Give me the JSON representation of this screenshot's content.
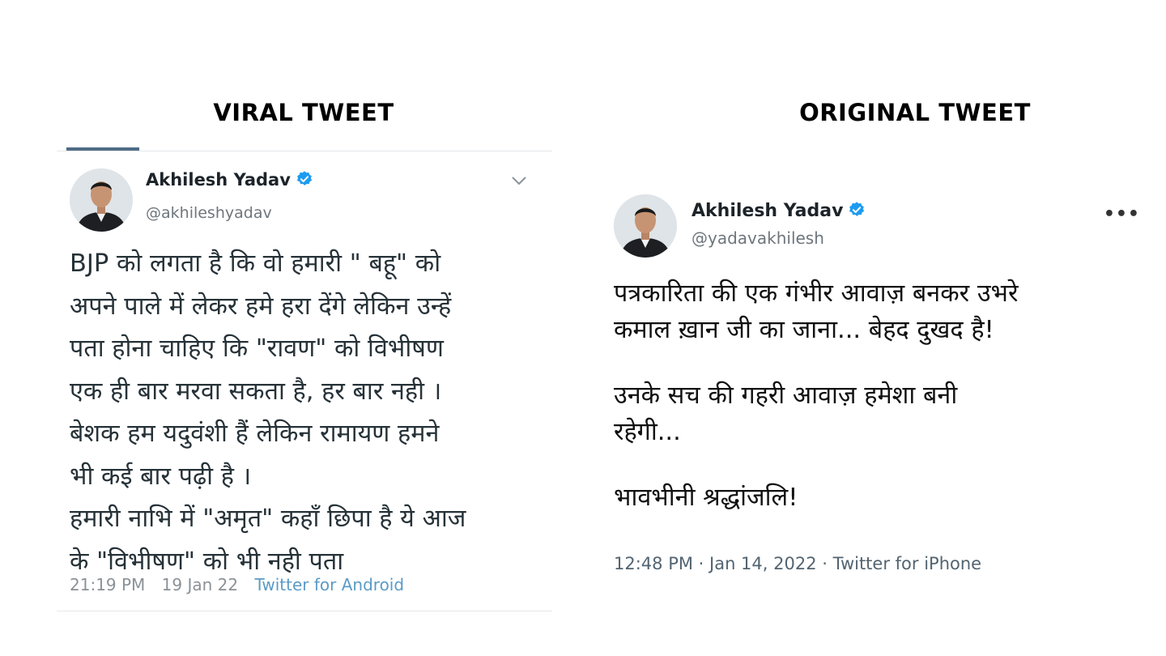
{
  "headings": {
    "left": "VIRAL TWEET",
    "right": "ORIGINAL TWEET"
  },
  "viral_tweet": {
    "author_name": "Akhilesh Yadav",
    "handle": "@akhileshyadav",
    "lines": [
      "BJP को लगता है कि वो हमारी \" बहू\" को",
      "अपने पाले में लेकर हमे हरा देंगे लेकिन उन्हें",
      "पता होना चाहिए कि \"रावण\" को विभीषण",
      "एक ही बार मरवा सकता है, हर बार नही ।",
      "बेशक हम यदुवंशी हैं लेकिन रामायण हमने",
      "भी कई बार पढ़ी है ।",
      "हमारी नाभि में \"अमृत\" कहाँ छिपा है ये आज",
      "के \"विभीषण\" को भी नही पता"
    ],
    "time": "21:19 PM",
    "date": "19 Jan 22",
    "source": "Twitter for Android",
    "icons": {
      "verified": "verified-badge-icon",
      "menu": "chevron-down-icon"
    },
    "colors": {
      "source_link": "#5b9bc6",
      "verified": "#1d9bf0"
    }
  },
  "original_tweet": {
    "author_name": "Akhilesh Yadav",
    "handle": "@yadavakhilesh",
    "paragraphs": [
      [
        "पत्रकारिता की एक गंभीर आवाज़ बनकर उभरे",
        "कमाल ख़ान जी का जाना... बेहद दुखद है!"
      ],
      [
        "उनके सच की गहरी आवाज़ हमेशा बनी",
        "रहेगी..."
      ],
      [
        "भावभीनी श्रद्धांजलि!"
      ]
    ],
    "meta": "12:48 PM · Jan 14, 2022 · Twitter for iPhone",
    "more_menu": "•••",
    "icons": {
      "verified": "verified-badge-icon",
      "menu": "more-horizontal-icon"
    }
  }
}
